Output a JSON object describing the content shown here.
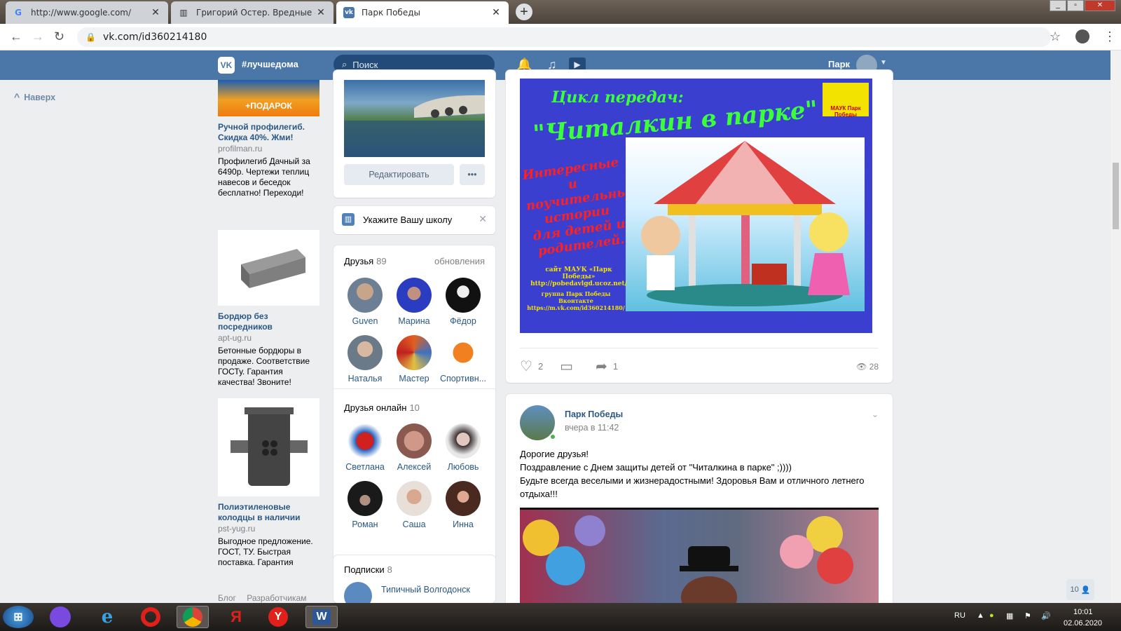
{
  "browser": {
    "tabs": [
      {
        "title": "http://www.google.com/",
        "icon": "G"
      },
      {
        "title": "Григорий Остер. Вредные сове",
        "icon": "▥"
      },
      {
        "title": "Парк Победы",
        "icon": "vk"
      }
    ],
    "url": "vk.com/id360214180"
  },
  "vk": {
    "hashtag": "#лучшедома",
    "search_placeholder": "Поиск",
    "user_name": "Парк",
    "nav_up": "Наверх",
    "accent": "#4a76a8"
  },
  "ads": [
    {
      "badge": "+ПОДАРОК",
      "title": "Ручной профилегиб. Скидка 40%. Жми!",
      "site": "profilman.ru",
      "text": "Профилегиб Дачный за 6490р. Чертежи теплиц навесов и беседок бесплатно! Переходи!"
    },
    {
      "title": "Бордюр без посредников",
      "site": "apt-ug.ru",
      "text": "Бетонные бордюры в продаже. Соответствие ГОСТу. Гарантия качества! Звоните!"
    },
    {
      "title": "Полиэтиленовые колодцы в наличии",
      "site": "pst-yug.ru",
      "text": "Выгодное предложение. ГОСТ, ТУ. Быстрая поставка. Гарантия"
    }
  ],
  "footer_links": [
    "Блог",
    "Разработчикам"
  ],
  "profile": {
    "edit_button": "Редактировать",
    "more_button": "•••",
    "school_prompt": "Укажите Вашу школу"
  },
  "friends": {
    "label": "Друзья",
    "count": "89",
    "updates": "обновления",
    "list": [
      "Guven",
      "Марина",
      "Фёдор",
      "Наталья",
      "Мастер",
      "Спортивн..."
    ]
  },
  "friends_online": {
    "label": "Друзья онлайн",
    "count": "10",
    "list": [
      "Светлана",
      "Алексей",
      "Любовь",
      "Роман",
      "Саша",
      "Инна"
    ]
  },
  "subscriptions": {
    "label": "Подписки",
    "count": "8",
    "first": "Типичный Волгодонск"
  },
  "post1": {
    "poster_title": "Цикл передач:",
    "poster_main": "\"Читалкин в парке\"",
    "poster_side": "Интересные и поучительные истории для детей и родителей.",
    "poster_logo": "МАУК Парк Победы",
    "poster_site": "сайт МАУК «Парк Победы» http://pobedavlgd.ucoz.net/",
    "poster_group": "группа Парк Победы Вконтакте https://m.vk.com/id360214180/",
    "likes": "2",
    "shares": "1",
    "views": "28"
  },
  "post2": {
    "author": "Парк Победы",
    "time": "вчера в 11:42",
    "lines": [
      "Дорогие друзья!",
      "Поздравление с Днем защиты детей от \"Читалкина в парке\" ;))))",
      "Будьте всегда веселыми и жизнерадостными! Здоровья Вам и отличного летнего отдыха!!!"
    ]
  },
  "fast_chat": "10",
  "taskbar": {
    "lang": "RU",
    "time": "10:01",
    "date": "02.06.2020"
  }
}
